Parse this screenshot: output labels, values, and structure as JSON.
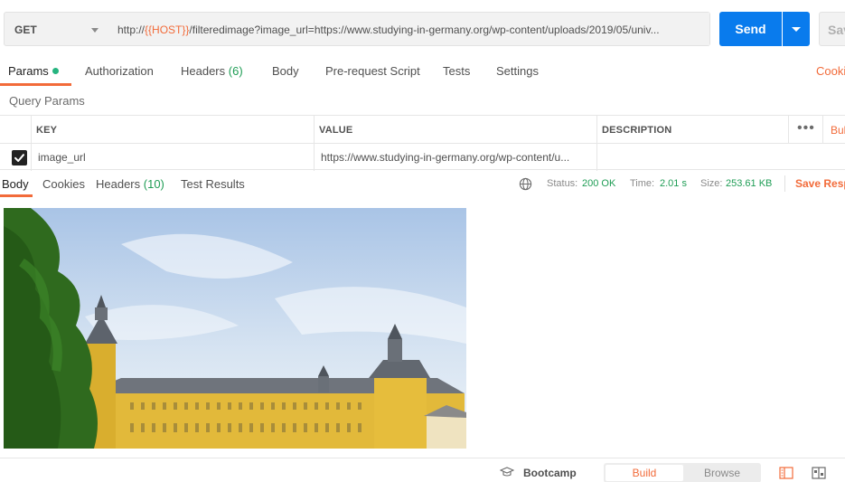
{
  "request": {
    "method": "GET",
    "url_prefix": "http://",
    "url_variable": "{{HOST}}",
    "url_suffix": "/filteredimage?image_url=https://www.studying-in-germany.org/wp-content/uploads/2019/05/univ...",
    "send_label": "Send",
    "save_label": "Sav"
  },
  "request_tabs": {
    "params": "Params",
    "authorization": "Authorization",
    "headers": "Headers",
    "headers_count": "(6)",
    "body": "Body",
    "pre_request": "Pre-request Script",
    "tests": "Tests",
    "settings": "Settings",
    "cookies": "Cooki"
  },
  "query_params": {
    "title": "Query Params",
    "headers": {
      "key": "KEY",
      "value": "VALUE",
      "description": "DESCRIPTION",
      "bulk_edit": "Bul"
    },
    "rows": [
      {
        "checked": true,
        "key": "image_url",
        "value": "https://www.studying-in-germany.org/wp-content/u...",
        "description": ""
      }
    ]
  },
  "response_tabs": {
    "body": "Body",
    "cookies": "Cookies",
    "headers": "Headers",
    "headers_count": "(10)",
    "test_results": "Test Results"
  },
  "response_meta": {
    "status_label": "Status:",
    "status_value": "200 OK",
    "time_label": "Time:",
    "time_value": "2.01 s",
    "size_label": "Size:",
    "size_value": "253.61 KB",
    "save_response": "Save Resp"
  },
  "status_bar": {
    "bootcamp": "Bootcamp",
    "build": "Build",
    "browse": "Browse"
  },
  "colors": {
    "accent": "#f26b3a",
    "primary": "#097bed",
    "success": "#1f9d55"
  }
}
